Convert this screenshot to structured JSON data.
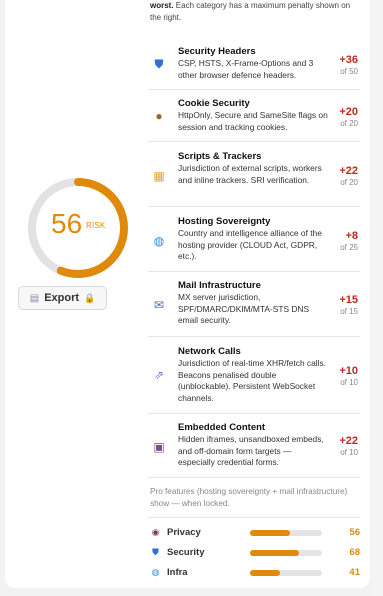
{
  "intro": {
    "bold": "worst.",
    "text": " Each category has a maximum penalty shown on the right."
  },
  "gauge": {
    "score": "56",
    "label": "RISK",
    "level": 0.56,
    "color": "#e08a0c"
  },
  "export": {
    "label": "Export",
    "icon": "document-icon",
    "lock_icon": "lock-icon"
  },
  "categories": [
    {
      "icon": "shield-icon",
      "name": "Security Headers",
      "desc": "CSP, HSTS, X-Frame-Options and 3 other browser defence headers.",
      "points": "+36",
      "max": "of 50"
    },
    {
      "icon": "cookie-icon",
      "name": "Cookie Security",
      "desc": "HttpOnly, Secure and SameSite flags on session and tracking cookies.",
      "points": "+20",
      "max": "of 20"
    },
    {
      "icon": "scroll-icon",
      "name": "Scripts & Trackers",
      "desc": "Jurisdiction of external scripts, workers and inline trackers. SRI verification.",
      "points": "+22",
      "max": "of 20"
    },
    {
      "icon": "globe-icon",
      "name": "Hosting Sovereignty",
      "desc": "Country and intelligence alliance of the hosting provider (CLOUD Act, GDPR, etc.).",
      "points": "+8",
      "max": "of 25"
    },
    {
      "icon": "mail-icon",
      "name": "Mail Infrastructure",
      "desc": "MX server jurisdiction, SPF/DMARC/DKIM/MTA-STS DNS email security.",
      "points": "+15",
      "max": "of 15"
    },
    {
      "icon": "network-icon",
      "name": "Network Calls",
      "desc": "Jurisdiction of real-time XHR/fetch calls. Beacons penalised double (unblockable). Persistent WebSocket channels.",
      "points": "+10",
      "max": "of 10"
    },
    {
      "icon": "frame-icon",
      "name": "Embedded Content",
      "desc": "Hidden iframes, unsandboxed embeds, and off-domain form targets — especially credential forms.",
      "points": "+22",
      "max": "of 10"
    }
  ],
  "note": "Pro features (hosting sovereignty + mail infrastructure) show — when locked.",
  "summary": [
    {
      "icon": "eye-icon",
      "label": "Privacy",
      "value": "56",
      "level": 0.56
    },
    {
      "icon": "shield-icon",
      "label": "Security",
      "value": "68",
      "level": 0.68
    },
    {
      "icon": "globe-icon",
      "label": "Infra",
      "value": "41",
      "level": 0.41
    }
  ],
  "colors": {
    "accent": "#e08a0c",
    "penalty": "#c0281e"
  }
}
